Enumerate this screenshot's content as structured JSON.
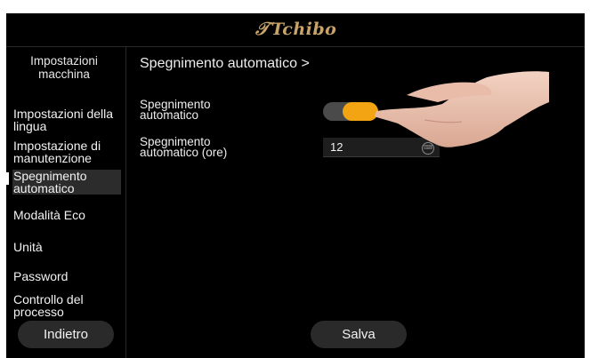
{
  "header": {
    "brand": "Tchibo"
  },
  "sidebar": {
    "title": "Impostazioni macchina",
    "items": [
      {
        "label": "Impostazioni della lingua"
      },
      {
        "label": "Impostazione di manutenzione"
      },
      {
        "label": "Spegnimento automatico",
        "active": true
      },
      {
        "label": "Modalità Eco"
      },
      {
        "label": "Unità"
      },
      {
        "label": "Password"
      },
      {
        "label": "Controllo del processo"
      }
    ],
    "back_label": "Indietro"
  },
  "main": {
    "title": "Spegnimento automatico >",
    "auto_off_label": "Spegnimento automatico",
    "auto_off_enabled": true,
    "hours_label": "Spegnimento automatico (ore)",
    "hours_value": "12",
    "save_label": "Salva"
  },
  "colors": {
    "accent": "#f2a413",
    "brand": "#c9a46a",
    "background": "#000000"
  },
  "icons": {
    "logo": "tchibo-logo",
    "field": "keyboard-icon"
  }
}
